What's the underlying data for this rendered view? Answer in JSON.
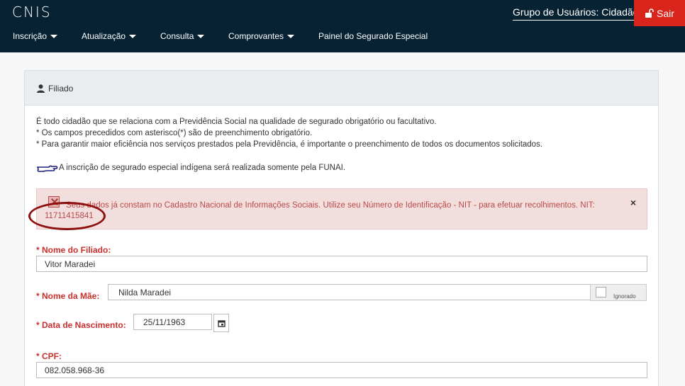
{
  "header": {
    "logo": "CNIS",
    "user_group": "Grupo de Usuários: Cidadão",
    "logout_label": "Sair",
    "nav": [
      {
        "label": "Inscrição",
        "has_dropdown": true
      },
      {
        "label": "Atualização",
        "has_dropdown": true
      },
      {
        "label": "Consulta",
        "has_dropdown": true
      },
      {
        "label": "Comprovantes",
        "has_dropdown": true
      },
      {
        "label": "Painel do Segurado Especial",
        "has_dropdown": false
      }
    ],
    "colors": {
      "bar": "#062233",
      "logout": "#d9241c"
    }
  },
  "panel": {
    "title": "Filiado",
    "intro": [
      "É todo cidadão que se relaciona com a Previdência Social na qualidade de segurado obrigatório ou facultativo.",
      "* Os campos precedidos com asterisco(*) são de preenchimento obrigatório.",
      "* Para garantir maior eficiência nos serviços prestados pela Previdência, é importante o preenchimento de todos os documentos solicitados."
    ],
    "note": "A inscrição de segurado especial indígena será realizada somente pela FUNAI.",
    "alert": {
      "line1": "Seus dados já constam no Cadastro Nacional de Informações Sociais. Utilize seu Número de Identificação - NIT - para efetuar recolhimentos. NIT:",
      "nit": "11711415841",
      "close": "×"
    }
  },
  "form": {
    "nome_filiado": {
      "label": "* Nome do Filiado:",
      "value": "Vitor Maradei"
    },
    "nome_mae": {
      "label": "* Nome da Mãe:",
      "value": "Nilda Maradei",
      "ignored_label": "Ignorado"
    },
    "data_nascimento": {
      "label": "* Data de Nascimento:",
      "value": "25/11/1963"
    },
    "cpf": {
      "label": "* CPF:",
      "value": "082.058.968-36"
    }
  }
}
